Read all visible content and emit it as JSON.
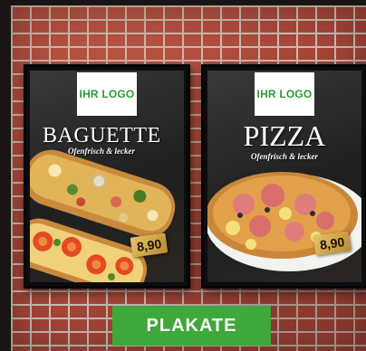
{
  "posters": [
    {
      "logo": "IHR LOGO",
      "title": "BAGUETTE",
      "subtitle": "Ofenfrisch & lecker",
      "price": "8,90"
    },
    {
      "logo": "IHR LOGO",
      "title": "PIZZA",
      "subtitle": "Ofenfrisch & lecker",
      "price": "8,90"
    }
  ],
  "cta": {
    "label": "PLAKATE"
  },
  "colors": {
    "brand_green": "#3fa83a",
    "logo_green": "#2e9a3c",
    "brick": "#a9473a",
    "price_gold": "#d4aa4c"
  }
}
